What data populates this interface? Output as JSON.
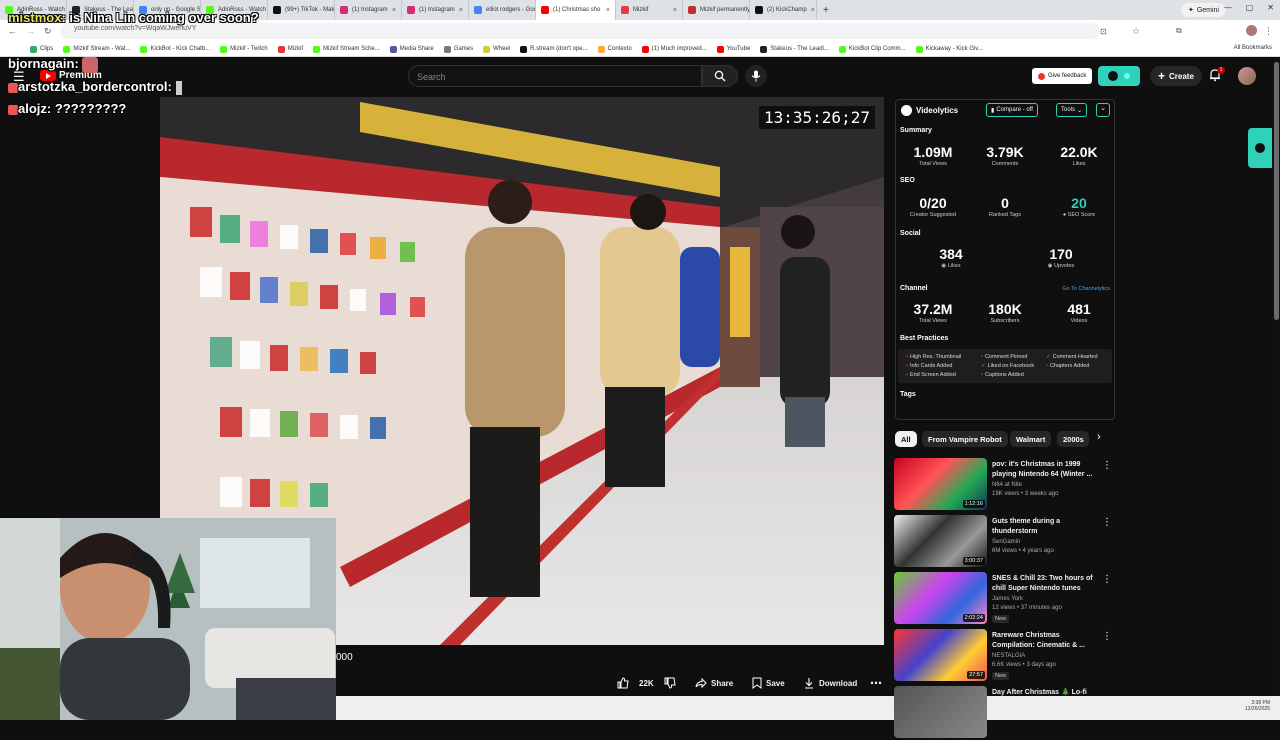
{
  "browser": {
    "tabs": [
      {
        "label": "AdinRoss - Watch cl",
        "color": "#53fc18"
      },
      {
        "label": "Stakeus - The Lead",
        "color": "#222222"
      },
      {
        "label": "only up - Google Sea",
        "color": "#4285f4"
      },
      {
        "label": "AdinRoss - Watch cl",
        "color": "#53fc18"
      },
      {
        "label": "(99+) TikTok - Make Y",
        "color": "#111111"
      },
      {
        "label": "(1) Instagram",
        "color": "#d62976"
      },
      {
        "label": "(1) Instagram",
        "color": "#d62976"
      },
      {
        "label": "elliot rodgers - Googl",
        "color": "#4285f4"
      },
      {
        "label": "(1) Christmas sho",
        "color": "#ff0000",
        "active": true
      },
      {
        "label": "Mizkif",
        "color": "#e63946"
      },
      {
        "label": "Mizkif permanently",
        "color": "#c4302b"
      },
      {
        "label": "(2) KickChamp",
        "color": "#111111"
      }
    ],
    "gemini_label": "Gemini",
    "url": "youtube.com/watch?v=WqaWJwenuVY",
    "bookmarks": [
      "Clips",
      "Mizkif Stream - Wat...",
      "KickBot - Kick Chatb...",
      "Mizkif - Twitch",
      "Mizkif",
      "Mizkif Stream Sche...",
      "Media Share",
      "Games",
      "Wheel",
      "R.stream (don't ope...",
      "Contexto",
      "(1) Much improved...",
      "YouTube",
      "Stakeus - The Leadi...",
      "KickBot Clip Comm...",
      "Kickaway - Kick Giv..."
    ],
    "all_bookmarks_label": "All Bookmarks"
  },
  "chat": [
    {
      "user": "mistmox",
      "message": "is Nina Lin coming over soon?"
    },
    {
      "user": "bjornagain",
      "message": ""
    },
    {
      "user": "arstotzka_bordercontrol",
      "message": ""
    },
    {
      "user": "alojz",
      "message": "?????????"
    }
  ],
  "youtube": {
    "premium_label": "Premium",
    "search_placeholder": "Search",
    "feedback_label": "Give feedback",
    "create_label": "Create",
    "notification_count": "1",
    "timestamp": "13:35:26;27",
    "caption_fragment": "000",
    "actions": {
      "likes": "22K",
      "share": "Share",
      "save": "Save",
      "download": "Download"
    },
    "chips": [
      "All",
      "From Vampire Robot",
      "Walmart",
      "2000s"
    ]
  },
  "videolytics": {
    "brand": "Videolytics",
    "compare_label": "Compare - off",
    "tools_label": "Tools",
    "summary_title": "Summary",
    "summary": [
      {
        "value": "1.09M",
        "label": "Total Views"
      },
      {
        "value": "3.79K",
        "label": "Comments"
      },
      {
        "value": "22.0K",
        "label": "Likes"
      }
    ],
    "seo_title": "SEO",
    "seo": [
      {
        "value": "0/20",
        "label": "Creator Suggested"
      },
      {
        "value": "0",
        "label": "Ranked Tags"
      },
      {
        "value": "20",
        "label": "SEO Score"
      }
    ],
    "social_title": "Social",
    "social": [
      {
        "value": "384",
        "label": "Likes"
      },
      {
        "value": "170",
        "label": "Upvotes"
      }
    ],
    "channel_title": "Channel",
    "channel_link": "Go To Channelytics",
    "channel": [
      {
        "value": "37.2M",
        "label": "Total Views"
      },
      {
        "value": "180K",
        "label": "Subscribers"
      },
      {
        "value": "481",
        "label": "Videos"
      }
    ],
    "best_practices_title": "Best Practices",
    "best_practices": [
      {
        "label": "High Res. Thumbnail",
        "ok": false
      },
      {
        "label": "Comment Pinned",
        "ok": false
      },
      {
        "label": "Comment Hearted",
        "ok": true
      },
      {
        "label": "Info Cards Added",
        "ok": false
      },
      {
        "label": "Liked on Facebook",
        "ok": true
      },
      {
        "label": "Chapters Added",
        "ok": false
      },
      {
        "label": "End Screen Added",
        "ok": false
      },
      {
        "label": "Captions Added",
        "ok": false
      }
    ],
    "tags_title": "Tags"
  },
  "recommendations": [
    {
      "title": "pov: it's Christmas in 1999 playing Nintendo 64 (Winter ...",
      "channel": "N64 at Nite",
      "meta": "19K views • 3 weeks ago",
      "duration": "1:12:16",
      "badge": ""
    },
    {
      "title": "Guts theme during a thunderstorm",
      "channel": "SenGamin",
      "meta": "6M views • 4 years ago",
      "duration": "3:00:37",
      "badge": ""
    },
    {
      "title": "SNES & Chill 23: Two hours of chill Super Nintendo tunes",
      "channel": "James York",
      "meta": "12 views • 37 minutes ago",
      "duration": "2:02:24",
      "badge": "New"
    },
    {
      "title": "Rareware Christmas Compilation: Cinematic & ...",
      "channel": "NESTALGIA",
      "meta": "6.6K views • 3 days ago",
      "duration": "27:57",
      "badge": "New"
    },
    {
      "title": "Day After Christmas 🎄 Lo-fi",
      "channel": "",
      "meta": "",
      "duration": "",
      "badge": ""
    }
  ],
  "system": {
    "time": "3:38 PM",
    "date": "12/26/2025"
  }
}
